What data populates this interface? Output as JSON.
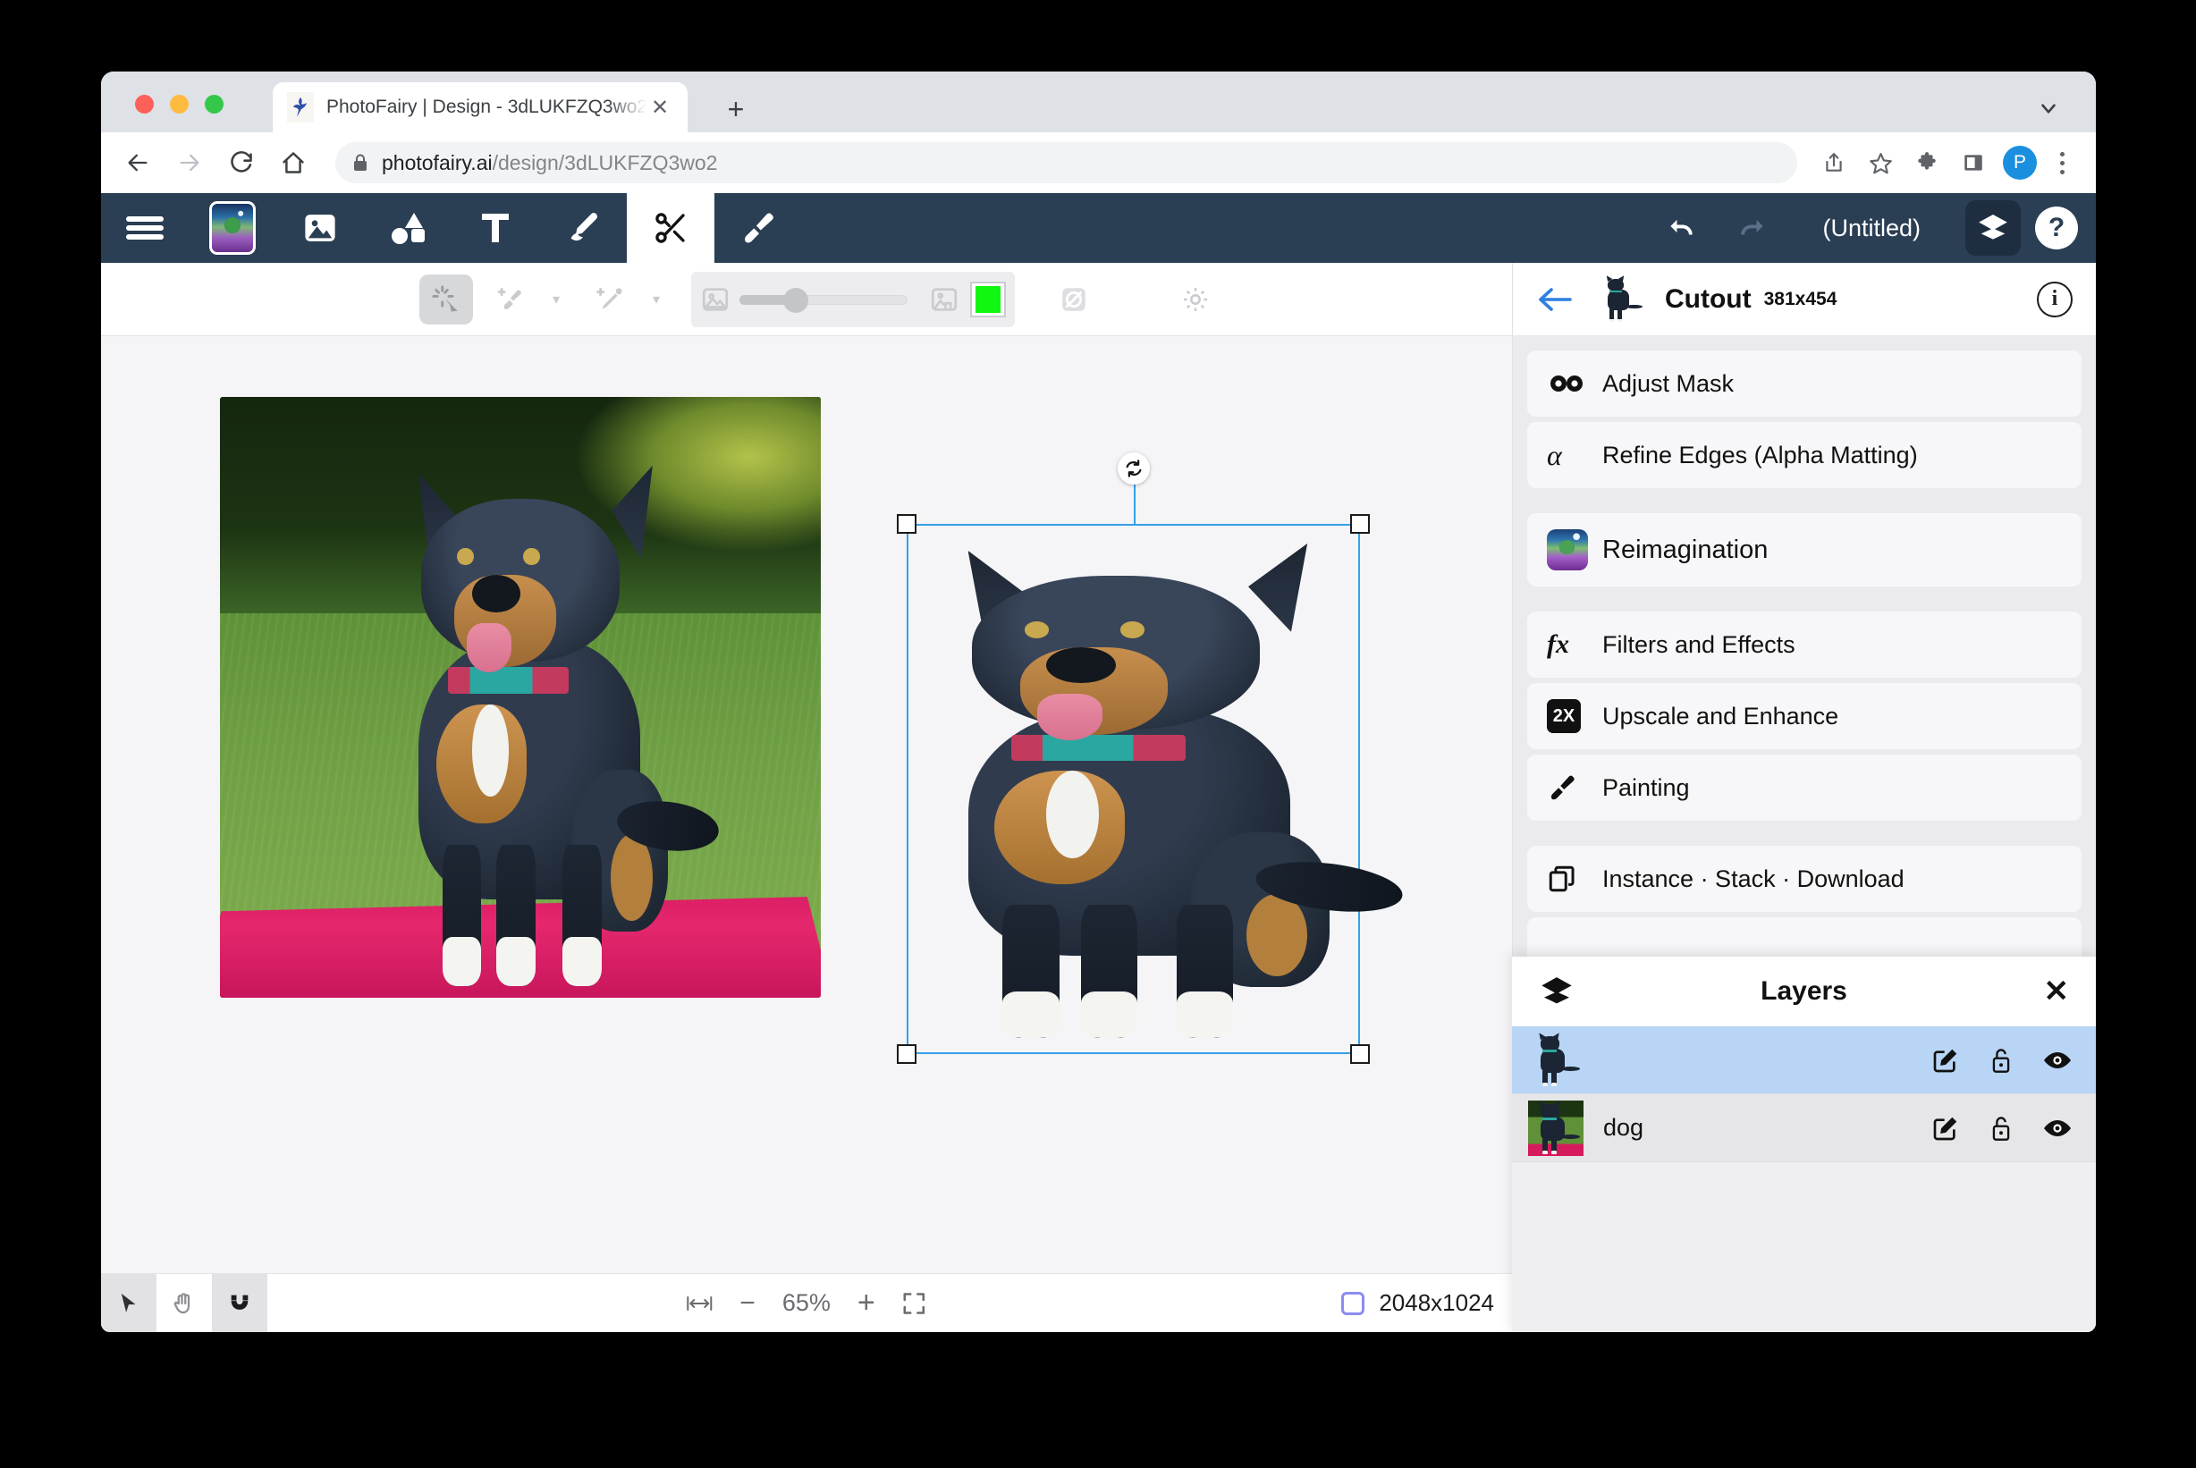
{
  "browser": {
    "tab": {
      "title": "PhotoFairy | Design - 3dLUKFZQ3wo2",
      "favicon": "fairy-icon",
      "close": "✕"
    },
    "new_tab": "+",
    "url_domain": "photofairy.ai",
    "url_path": "/design/3dLUKFZQ3wo2",
    "back": "←",
    "forward": "→",
    "reload": "↻",
    "home": "⌂",
    "profile_initial": "P"
  },
  "appbar": {
    "menu": "hamburger-icon",
    "tabs": [
      {
        "name": "generate",
        "icon": "image-thumbnail-icon",
        "active": false
      },
      {
        "name": "images",
        "icon": "photo-icon",
        "active": false
      },
      {
        "name": "shapes",
        "icon": "shapes-icon",
        "active": false
      },
      {
        "name": "text",
        "icon": "text-icon",
        "label": "T",
        "active": false
      },
      {
        "name": "pen",
        "icon": "pen-icon",
        "active": false
      },
      {
        "name": "cutout",
        "icon": "scissors-icon",
        "active": true
      },
      {
        "name": "brush",
        "icon": "paintbrush-icon",
        "active": false
      }
    ],
    "undo": "undo-icon",
    "redo": "redo-icon",
    "document_title": "(Untitled)",
    "layers_toggle": "layers-icon",
    "help": "?"
  },
  "options": {
    "select_tool": "magic-select-icon",
    "add_brush": "add-brush-icon",
    "add_eyedropper": "add-eyedropper-icon",
    "caret": "▾",
    "image_icon": "image-icon",
    "slider_value": 36,
    "background_image_icon": "background-image-icon",
    "color_swatch": "#12f712",
    "transparency_icon": "transparency-icon",
    "settings_icon": "gear-icon"
  },
  "panel": {
    "back": "←",
    "title": "Cutout",
    "dimensions": "381x454",
    "info": "i",
    "groups": [
      {
        "items": [
          {
            "label": "Adjust Mask",
            "icon": "mask-icon",
            "glyph": "⚫⚫"
          },
          {
            "label": "Refine Edges (Alpha Matting)",
            "icon": "alpha-icon",
            "glyph": "α"
          }
        ]
      },
      {
        "items": [
          {
            "label": "Reimagination",
            "icon": "reimagination-icon",
            "glyph": ""
          }
        ]
      },
      {
        "items": [
          {
            "label": "Filters and Effects",
            "icon": "fx-icon",
            "glyph": "fx"
          },
          {
            "label": "Upscale and Enhance",
            "icon": "upscale-2x-icon",
            "glyph": "2X"
          },
          {
            "label": "Painting",
            "icon": "paintbrush-icon",
            "glyph": ""
          }
        ]
      },
      {
        "items": [
          {
            "label": "Instance · Stack · Download",
            "icon": "copy-icon",
            "glyph": ""
          }
        ]
      }
    ]
  },
  "layers": {
    "icon": "layers-icon",
    "title": "Layers",
    "close": "✕",
    "rows": [
      {
        "name": "",
        "thumb": "cutout-thumbnail",
        "selected": true,
        "edit": "edit-icon",
        "lock": "unlock-icon",
        "visibility": "eye-icon"
      },
      {
        "name": "dog",
        "thumb": "photo-thumbnail",
        "selected": false,
        "edit": "edit-icon",
        "lock": "unlock-icon",
        "visibility": "eye-icon"
      }
    ]
  },
  "statusbar": {
    "tools": [
      {
        "name": "select-tool",
        "icon": "cursor-icon",
        "active": true
      },
      {
        "name": "pan-tool",
        "icon": "hand-icon",
        "active": false
      },
      {
        "name": "magnet-tool",
        "icon": "magnet-icon",
        "active": true
      }
    ],
    "fit_width": "fit-width-icon",
    "zoom_out": "−",
    "zoom_level": "65%",
    "zoom_in": "+",
    "fullscreen": "fullscreen-icon",
    "canvas_size": "2048x1024"
  },
  "canvas": {
    "source_layer_name": "dog",
    "selection": {
      "rotate_handle": "rotate-icon",
      "handles": [
        "top-left",
        "top-right",
        "bottom-left",
        "bottom-right"
      ]
    }
  }
}
